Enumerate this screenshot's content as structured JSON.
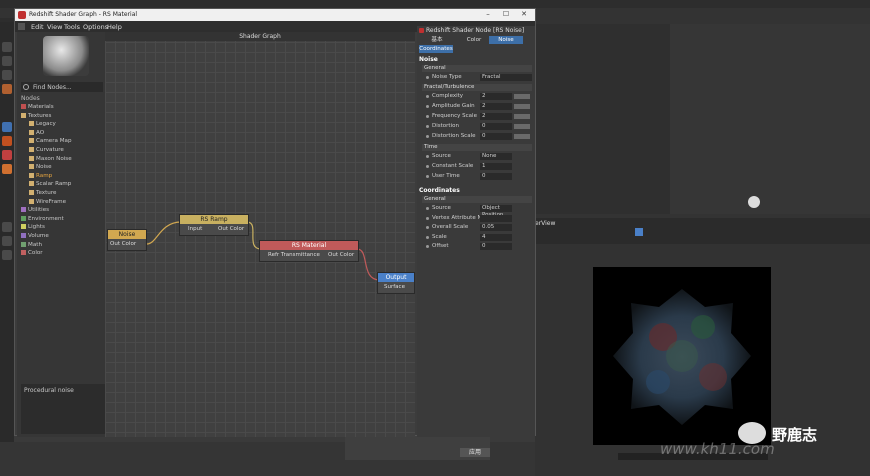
{
  "background_app": {
    "viewport_label": "erView",
    "bottom_apply": "应用",
    "watermark": "野鹿志",
    "watermark_url": "www.kh11.com"
  },
  "window": {
    "title": "Redshift Shader Graph - RS Material",
    "controls": [
      "–",
      "☐",
      "✕"
    ]
  },
  "menu": [
    "Edit",
    "View",
    "Tools",
    "Options",
    "Help"
  ],
  "browser": {
    "find_placeholder": "Find Nodes...",
    "nodes_header": "Nodes",
    "tree": [
      {
        "label": "Materials",
        "color": "#c05050",
        "level": 0
      },
      {
        "label": "Textures",
        "color": "#d2b070",
        "level": 0
      },
      {
        "label": "Legacy",
        "color": "#d2b070",
        "level": 1
      },
      {
        "label": "AO",
        "color": "#d2b070",
        "level": 1
      },
      {
        "label": "Camera Map",
        "color": "#d2b070",
        "level": 1
      },
      {
        "label": "Curvature",
        "color": "#d2b070",
        "level": 1
      },
      {
        "label": "Maxon Noise",
        "color": "#d2b070",
        "level": 1
      },
      {
        "label": "Noise",
        "color": "#d2b070",
        "level": 1
      },
      {
        "label": "Ramp",
        "color": "#d2b070",
        "level": 1,
        "active": true
      },
      {
        "label": "Scalar Ramp",
        "color": "#d2b070",
        "level": 1
      },
      {
        "label": "Texture",
        "color": "#d2b070",
        "level": 1
      },
      {
        "label": "WireFrame",
        "color": "#d2b070",
        "level": 1
      },
      {
        "label": "Utilities",
        "color": "#a070c0",
        "level": 0
      },
      {
        "label": "Environment",
        "color": "#60a060",
        "level": 0
      },
      {
        "label": "Lights",
        "color": "#d0d060",
        "level": 0
      },
      {
        "label": "Volume",
        "color": "#9070c0",
        "level": 0
      },
      {
        "label": "Math",
        "color": "#70a070",
        "level": 0
      },
      {
        "label": "Color",
        "color": "#c06060",
        "level": 0
      }
    ],
    "description": "Procedural noise"
  },
  "graph": {
    "title": "Shader Graph",
    "nodes": {
      "noise": {
        "title": "Noise",
        "out": "Out Color",
        "color": "#d2a850"
      },
      "ramp": {
        "title": "RS Ramp",
        "in": "Input",
        "out": "Out Color",
        "color": "#c8b060"
      },
      "material": {
        "title": "RS Material",
        "in": "Refr Transmittance",
        "out": "Out Color",
        "color": "#c05a5a"
      },
      "output": {
        "title": "Output",
        "in": "Surface",
        "color": "#4a80c8"
      }
    }
  },
  "props": {
    "title": "Redshift Shader Node [RS Noise]",
    "tabs": [
      "基本",
      "Color",
      "Noise"
    ],
    "sub_tab": "Coordinates",
    "section_noise": "Noise",
    "group_general": "General",
    "noise_type_label": "Noise Type",
    "noise_type_value": "Fractal",
    "group_fractal": "Fractal/Turbulence",
    "fractal_rows": [
      {
        "label": "Complexity",
        "value": "2"
      },
      {
        "label": "Amplitude Gain",
        "value": "2"
      },
      {
        "label": "Frequency Scale",
        "value": "2"
      },
      {
        "label": "Distortion",
        "value": "0"
      },
      {
        "label": "Distortion Scale",
        "value": "0"
      }
    ],
    "group_time": "Time",
    "time_rows": [
      {
        "label": "Source",
        "value": "None"
      },
      {
        "label": "Constant Scale",
        "value": "1"
      },
      {
        "label": "User Time",
        "value": "0"
      }
    ],
    "section_coordinates": "Coordinates",
    "group_general2": "General",
    "coord_rows": [
      {
        "label": "Source",
        "value": "Object Position"
      },
      {
        "label": "Vertex Attribute Name",
        "value": ""
      },
      {
        "label": "Overall Scale",
        "value": "0.05"
      },
      {
        "label": "Scale",
        "value": "4"
      },
      {
        "label": "Offset",
        "value": "0"
      }
    ]
  },
  "colors": {
    "accent_blue": "#4a80c8",
    "tab_active": "#3d6fa8"
  }
}
